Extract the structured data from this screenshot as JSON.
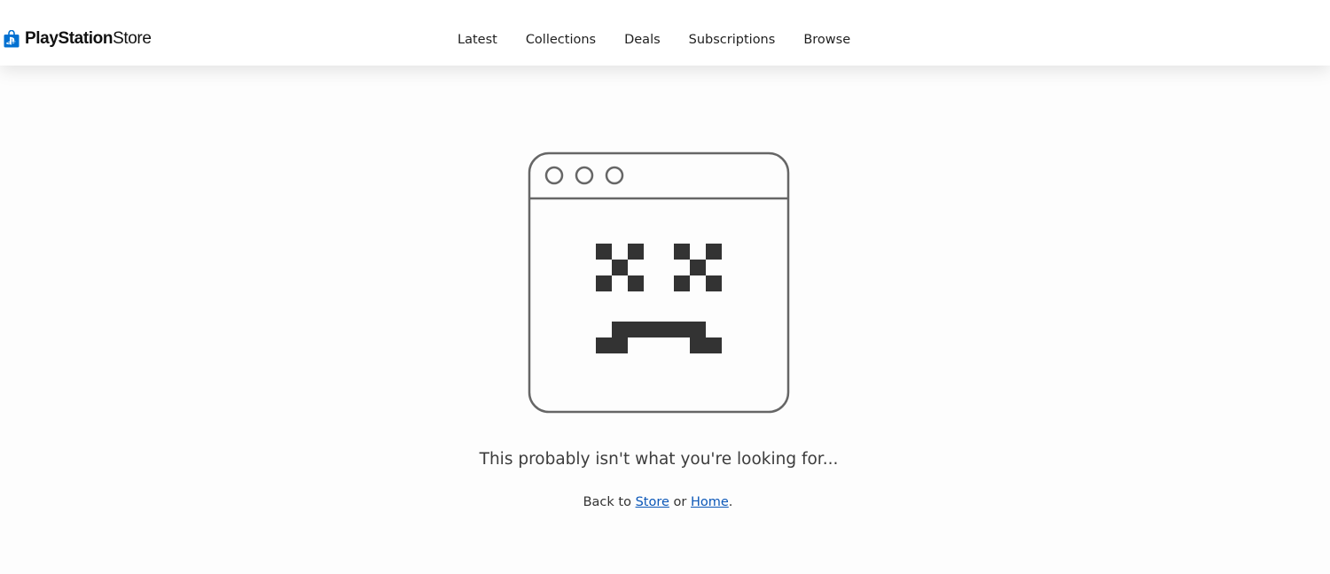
{
  "header": {
    "logo": {
      "icon": "playstation-store-bag-icon",
      "brand_bold": "PlayStation",
      "brand_light": "Store"
    },
    "nav": [
      {
        "label": "Latest"
      },
      {
        "label": "Collections"
      },
      {
        "label": "Deals"
      },
      {
        "label": "Subscriptions"
      },
      {
        "label": "Browse"
      }
    ]
  },
  "error": {
    "illustration": "sad-browser-window-icon",
    "message": "This probably isn't what you're looking for...",
    "back_prefix": "Back to",
    "store_link": "Store",
    "separator": "or",
    "home_link": "Home",
    "suffix": "."
  },
  "colors": {
    "brand_blue": "#0070d1",
    "link": "#0b57b8",
    "illustration_stroke": "#666666",
    "illustration_fill": "#333333"
  }
}
